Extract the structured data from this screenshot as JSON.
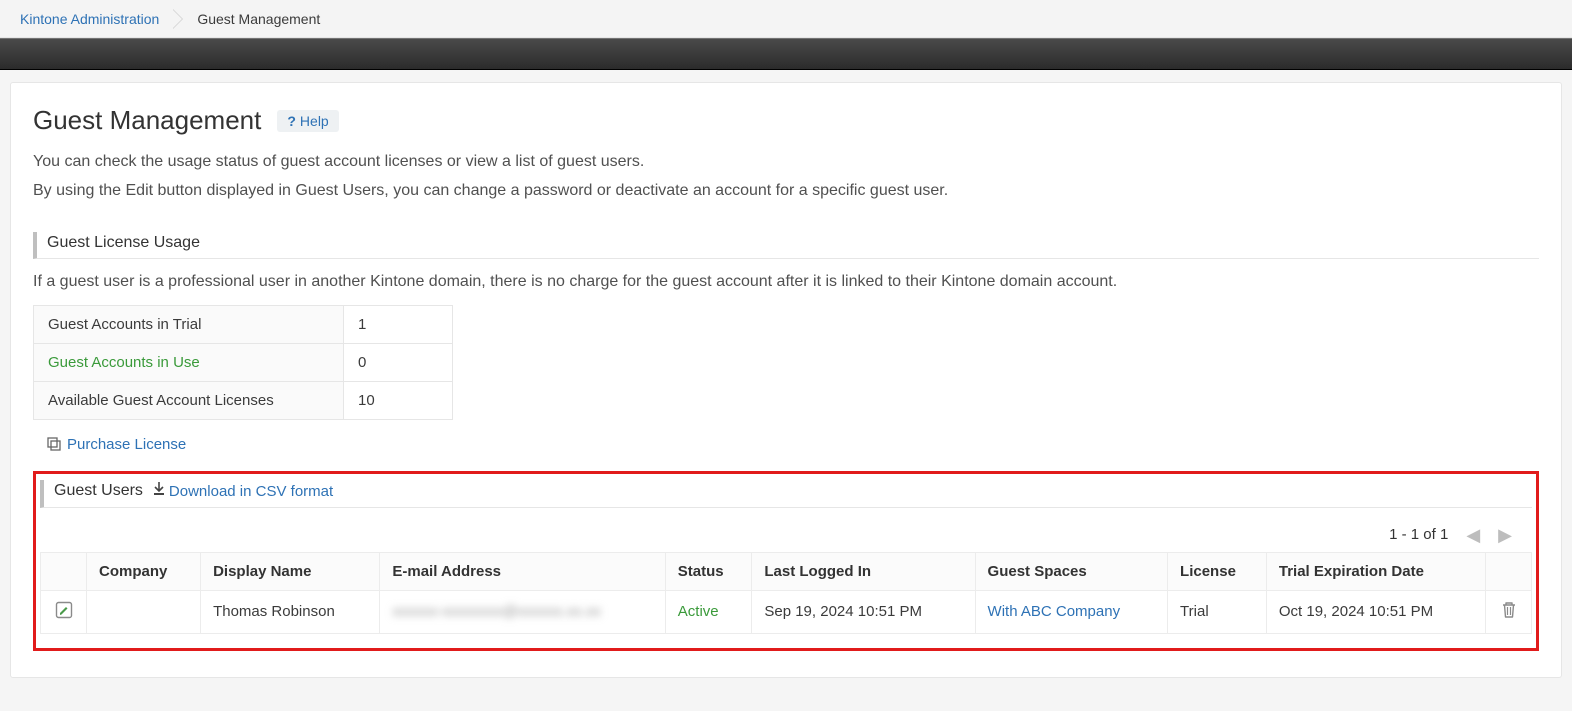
{
  "breadcrumb": {
    "root_label": "Kintone Administration",
    "current_label": "Guest Management"
  },
  "page": {
    "title": "Guest Management",
    "help_label": "Help",
    "intro_line1": "You can check the usage status of guest account licenses or view a list of guest users.",
    "intro_line2": "By using the Edit button displayed in Guest Users, you can change a password or deactivate an account for a specific guest user."
  },
  "license_usage": {
    "heading": "Guest License Usage",
    "note": "If a guest user is a professional user in another Kintone domain, there is no charge for the guest account after it is linked to their Kintone domain account.",
    "rows": [
      {
        "label": "Guest Accounts in Trial",
        "value": "1",
        "link": false
      },
      {
        "label": "Guest Accounts in Use",
        "value": "0",
        "link": true
      },
      {
        "label": "Available Guest Account Licenses",
        "value": "10",
        "link": false
      }
    ],
    "purchase_link_label": "Purchase License"
  },
  "guest_users": {
    "heading": "Guest Users",
    "download_label": "Download in CSV format",
    "pager_text": "1 - 1 of 1",
    "columns": {
      "company": "Company",
      "display_name": "Display Name",
      "email": "E-mail Address",
      "status": "Status",
      "last_login": "Last Logged In",
      "guest_spaces": "Guest Spaces",
      "license": "License",
      "trial_exp": "Trial Expiration Date"
    },
    "rows": [
      {
        "company": "",
        "display_name": "Thomas Robinson",
        "email": "xxxxxx-xxxxxxxx@xxxxxx.xx.xx",
        "status": "Active",
        "last_login": "Sep 19, 2024 10:51 PM",
        "guest_spaces": "With ABC Company",
        "license": "Trial",
        "trial_exp": "Oct 19, 2024 10:51 PM"
      }
    ]
  }
}
